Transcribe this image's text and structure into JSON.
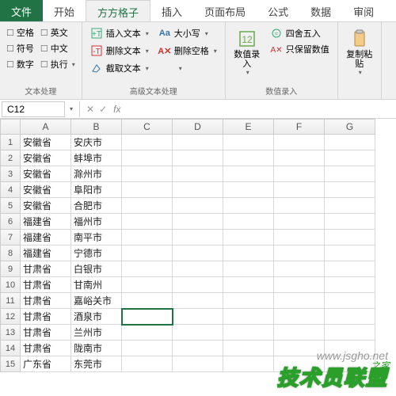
{
  "tabs": [
    "文件",
    "开始",
    "方方格子",
    "插入",
    "页面布局",
    "公式",
    "数据",
    "审阅"
  ],
  "active_tab_index": 2,
  "ribbon": {
    "group1": {
      "label": "文本处理",
      "items": [
        "空格",
        "英文",
        "符号",
        "中文",
        "数字",
        "执行"
      ]
    },
    "group2": {
      "label": "高级文本处理",
      "col1": [
        "插入文本",
        "删除文本",
        "截取文本"
      ],
      "col2a": "大小写",
      "col2b": "删除空格",
      "col2c": ""
    },
    "group3": {
      "label": "数值录入",
      "big": "数值录\n入",
      "items": [
        "四舍五入",
        "只保留数值"
      ]
    },
    "group4": {
      "big": "复制粘\n贴"
    }
  },
  "name_box": "C12",
  "fx_tools": [
    "✕",
    "✓"
  ],
  "fx_label": "fx",
  "columns": [
    "A",
    "B",
    "C",
    "D",
    "E",
    "F",
    "G"
  ],
  "rows": [
    {
      "n": 1,
      "A": "安徽省",
      "B": "安庆市"
    },
    {
      "n": 2,
      "A": "安徽省",
      "B": "蚌埠市"
    },
    {
      "n": 3,
      "A": "安徽省",
      "B": "滁州市"
    },
    {
      "n": 4,
      "A": "安徽省",
      "B": "阜阳市"
    },
    {
      "n": 5,
      "A": "安徽省",
      "B": "合肥市"
    },
    {
      "n": 6,
      "A": "福建省",
      "B": "福州市"
    },
    {
      "n": 7,
      "A": "福建省",
      "B": "南平市"
    },
    {
      "n": 8,
      "A": "福建省",
      "B": "宁德市"
    },
    {
      "n": 9,
      "A": "甘肃省",
      "B": "白银市"
    },
    {
      "n": 10,
      "A": "甘肃省",
      "B": "甘南州"
    },
    {
      "n": 11,
      "A": "甘肃省",
      "B": "嘉峪关市"
    },
    {
      "n": 12,
      "A": "甘肃省",
      "B": "酒泉市"
    },
    {
      "n": 13,
      "A": "甘肃省",
      "B": "兰州市"
    },
    {
      "n": 14,
      "A": "甘肃省",
      "B": "陇南市"
    },
    {
      "n": 15,
      "A": "广东省",
      "B": "东莞市"
    }
  ],
  "active_cell": {
    "row": 12,
    "col": "C"
  },
  "watermark": {
    "url": "www.jsgho.net",
    "banner": "技术员联盟",
    "small": "之家"
  }
}
